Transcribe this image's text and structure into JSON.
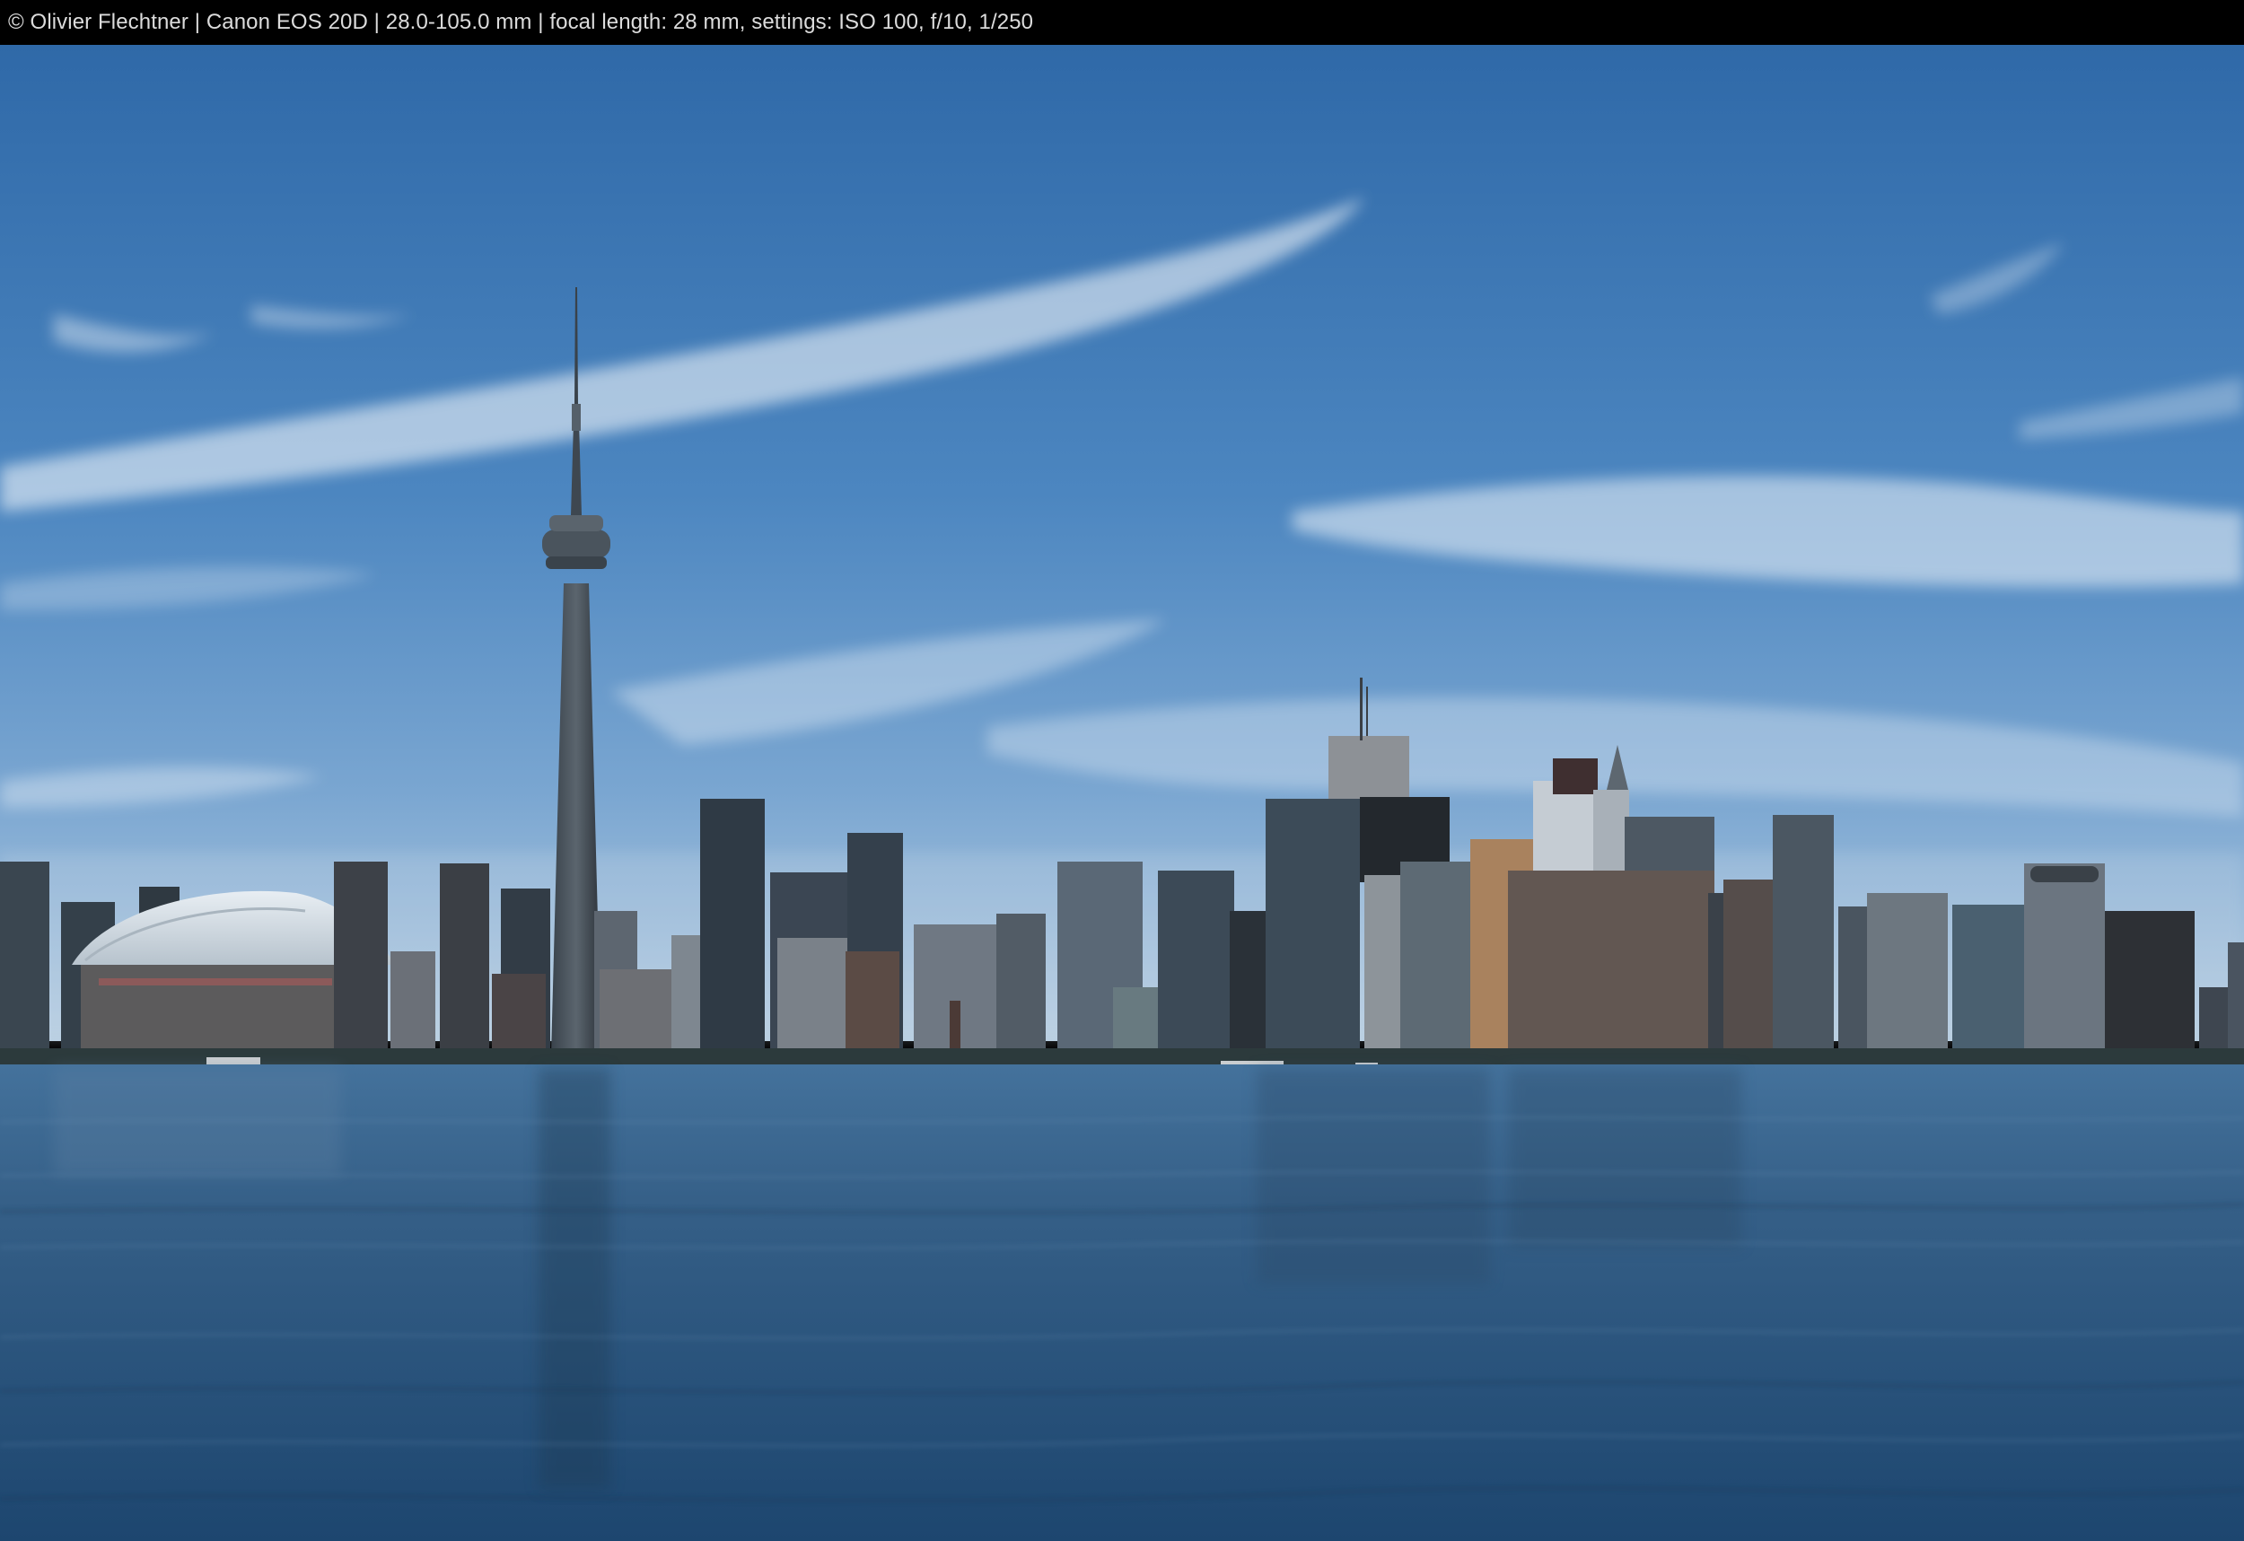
{
  "caption": "© Olivier Flechtner | Canon EOS 20D | 28.0-105.0 mm | focal length: 28 mm, settings: ISO 100, f/10, 1/250",
  "photo": {
    "subject": "city-skyline-waterfront",
    "colors": {
      "sky_top": "#2f69a8",
      "sky_mid": "#5b92c8",
      "sky_horizon": "#b9cfe2",
      "water_near": "#1f4a73",
      "water_far": "#3f6f99",
      "buildings_dark": "#2b3138",
      "buildings_mid": "#49535d",
      "stadium_dome": "#d5dde4"
    }
  }
}
